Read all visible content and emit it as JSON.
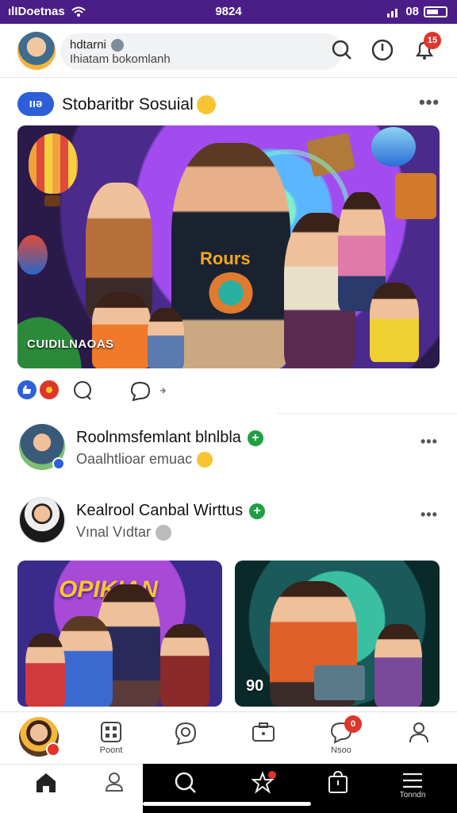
{
  "status_bar": {
    "carrier": "ılIDoetnas",
    "time": "9824",
    "battery_text": "08"
  },
  "topbar": {
    "profile_name": "hdtarni",
    "profile_subtitle": "Ihiatam bokomlanh",
    "icons": [
      "search-icon",
      "timer-icon",
      "notification-bell-icon"
    ],
    "notification_count": "15"
  },
  "post": {
    "tag_label": "ııə",
    "title": "Stobaritbr Sosuial",
    "image_caption": "CUIDILNAOAS",
    "shirt_text": "Rours",
    "actions": [
      "like-reaction-icon",
      "love-reaction-icon",
      "comment-icon",
      "share-icon"
    ]
  },
  "people": [
    {
      "name": "Roolnmsfemlant blnlbla",
      "subtitle": "Oaalhtlioar emuac",
      "verified": true
    },
    {
      "name": "Kealrool Canbal Wirttus",
      "subtitle": "Vınal Vıdtar",
      "verified": true
    }
  ],
  "cards": [
    {
      "banner": "OPIKIAN",
      "tag": ""
    },
    {
      "banner": "",
      "tag": "90"
    }
  ],
  "tabbar_primary": [
    {
      "icon": "profile-avatar",
      "label": "",
      "badge": ""
    },
    {
      "icon": "grid-icon",
      "label": "Poont"
    },
    {
      "icon": "search-bubble-icon",
      "label": ""
    },
    {
      "icon": "camera-icon",
      "label": ""
    },
    {
      "icon": "chat-icon",
      "label": "Nsoo",
      "badge": "0"
    },
    {
      "icon": "person-icon",
      "label": ""
    }
  ],
  "tabbar_secondary": [
    {
      "icon": "home-icon",
      "label": ""
    },
    {
      "icon": "person-outline-icon",
      "label": ""
    },
    {
      "icon": "search-icon",
      "label": ""
    },
    {
      "icon": "star-notify-icon",
      "label": ""
    },
    {
      "icon": "shopping-bag-icon",
      "label": ""
    },
    {
      "icon": "menu-icon",
      "label": "Tonndn"
    }
  ],
  "colors": {
    "status_bar": "#4a1e86",
    "accent_blue": "#2c5fd8",
    "verified_green": "#1fa045",
    "badge_red": "#e0352b"
  }
}
